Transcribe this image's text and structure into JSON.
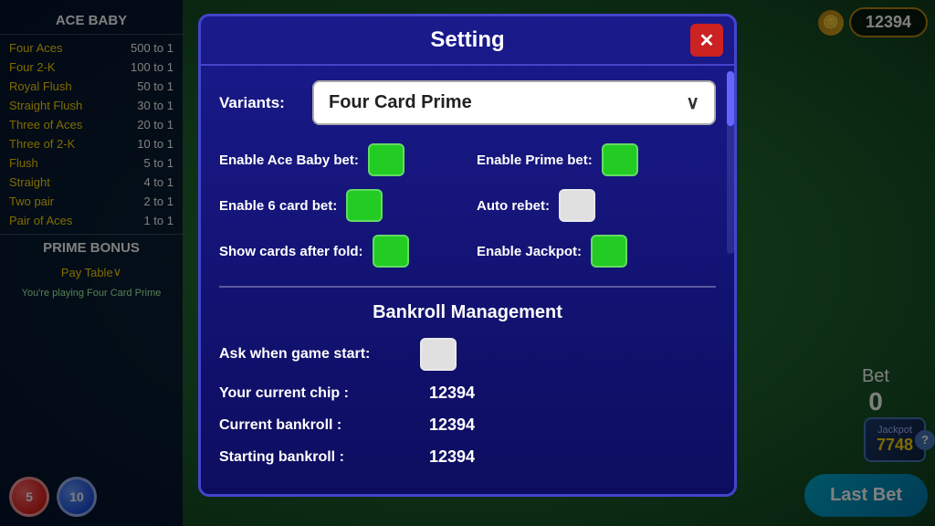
{
  "game": {
    "title": "ACE BABY",
    "balance": "12394",
    "jackpot_label": "Jackpot",
    "jackpot_value": "7748",
    "bet_label": "Bet",
    "bet_value": "0",
    "last_bet_label": "Last Bet",
    "chip1_value": "5",
    "chip2_value": "10"
  },
  "ace_baby_table": [
    {
      "hand": "Four Aces",
      "odds": "500 to 1"
    },
    {
      "hand": "Four 2-K",
      "odds": "100 to 1"
    },
    {
      "hand": "Royal Flush",
      "odds": "50 to 1"
    },
    {
      "hand": "Straight Flush",
      "odds": "30 to 1"
    },
    {
      "hand": "Three of Aces",
      "odds": "20 to 1"
    },
    {
      "hand": "Three of 2-K",
      "odds": "10 to 1"
    },
    {
      "hand": "Flush",
      "odds": "5 to 1"
    },
    {
      "hand": "Straight",
      "odds": "4 to 1"
    },
    {
      "hand": "Two pair",
      "odds": "2 to 1"
    },
    {
      "hand": "Pair of Aces",
      "odds": "1 to 1"
    }
  ],
  "prime_bonus": "PRIME BONUS",
  "pay_table": "Pay Table",
  "playing_text": "You're playing Four Card Prime",
  "modal": {
    "title": "Setting",
    "close_label": "✕",
    "variants_label": "Variants:",
    "selected_variant": "Four Card Prime",
    "toggles": [
      {
        "label": "Enable Ace Baby bet:",
        "state": "on",
        "id": "ace-baby-bet"
      },
      {
        "label": "Enable Prime bet:",
        "state": "on",
        "id": "prime-bet"
      },
      {
        "label": "Enable 6 card bet:",
        "state": "on",
        "id": "six-card-bet"
      },
      {
        "label": "Auto rebet:",
        "state": "off",
        "id": "auto-rebet"
      },
      {
        "label": "Show cards after fold:",
        "state": "on",
        "id": "show-cards"
      },
      {
        "label": "Enable Jackpot:",
        "state": "on",
        "id": "jackpot"
      }
    ],
    "bankroll": {
      "title": "Bankroll Management",
      "ask_label": "Ask when game start:",
      "ask_state": "off",
      "current_chip_label": "Your current chip :",
      "current_chip_value": "12394",
      "current_bankroll_label": "Current bankroll   :",
      "current_bankroll_value": "12394",
      "starting_bankroll_label": "Starting bankroll  :",
      "starting_bankroll_value": "12394"
    }
  }
}
